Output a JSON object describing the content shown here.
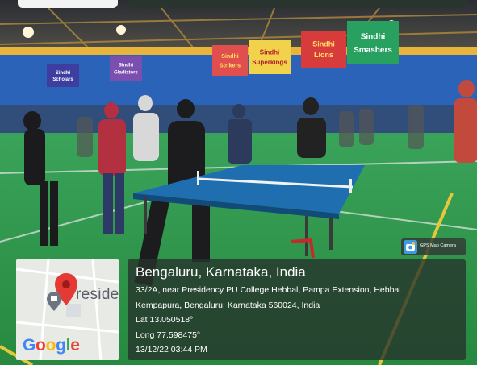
{
  "location": {
    "title": "Bengaluru, Karnataka, India",
    "address_line1": "33/2A, near Presidency PU College Hebbal, Pampa Extension, Hebbal",
    "address_line2": "Kempapura, Bengaluru, Karnataka 560024, India",
    "latitude": "Lat 13.050518°",
    "longitude": "Long 77.598475°",
    "datetime": "13/12/22 03:44 PM"
  },
  "map": {
    "place_label": "residen",
    "provider_logo": "Google"
  },
  "app_badge": {
    "label": "GPS Map Camera",
    "icon": "camera-map-icon"
  },
  "banners": [
    {
      "line1": "Sindhi",
      "line2": "Lions"
    },
    {
      "line1": "Sindhi",
      "line2": "Smashers"
    },
    {
      "line1": "Sindhi",
      "line2": "Superkings"
    },
    {
      "line1": "Sindhi",
      "line2": "Strikers"
    },
    {
      "line1": "Sindhi",
      "line2": "Gladiators"
    },
    {
      "line1": "Sindhi",
      "line2": "Scholars"
    }
  ],
  "colors": {
    "court_green": "#2f9a4c",
    "wall_blue": "#2b63b8",
    "overlay": "#26322c",
    "pin_red": "#e53935"
  }
}
